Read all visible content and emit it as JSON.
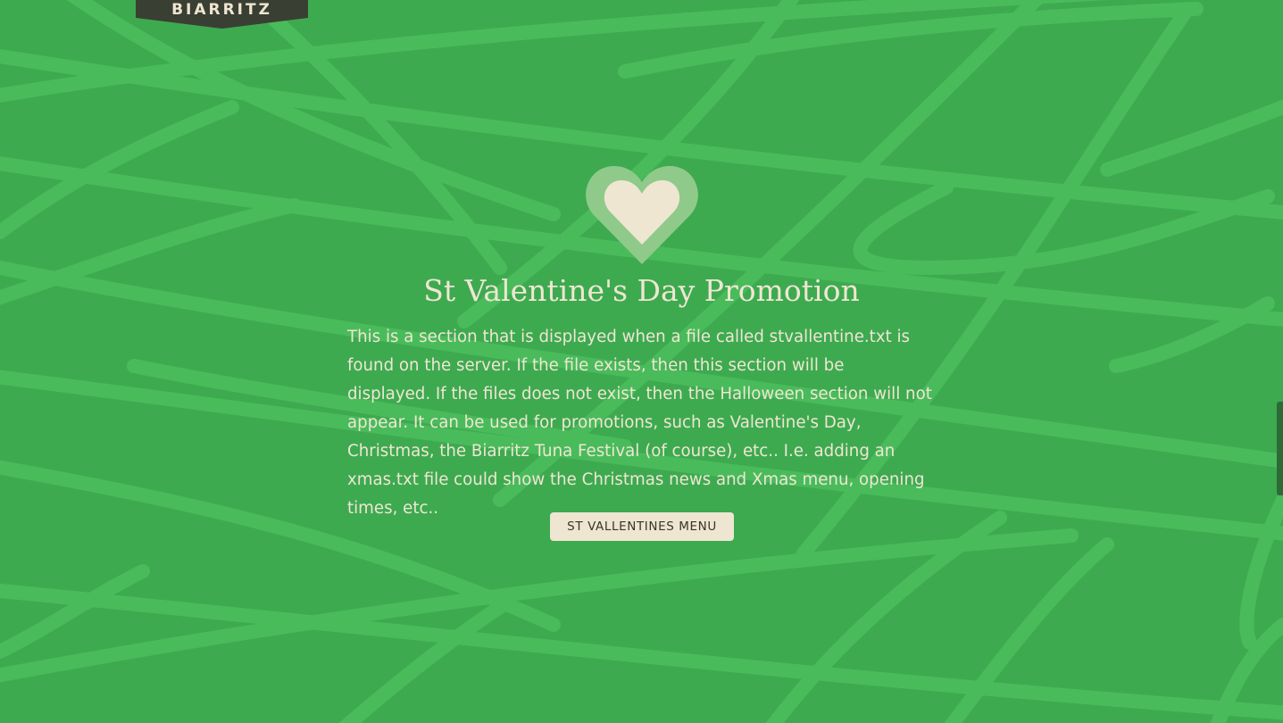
{
  "logo": {
    "text": "BIARRITZ"
  },
  "promo": {
    "icon": "heart-icon",
    "title": "St Valentine's Day Promotion",
    "body": "This is a section that is displayed when a file called stvallentine.txt is found on the server. If the file exists, then this section will be displayed. If the files does not exist, then the Halloween section will not appear. It can be used for promotions, such as Valentine's Day, Christmas, the Biarritz Tuna Festival (of course), etc.. I.e. adding an xmas.txt file could show the Christmas news and Xmas menu, opening times, etc..",
    "button_label": "ST VALLENTINES MENU"
  },
  "colors": {
    "background": "#3daa50",
    "scribble": "#4fc160",
    "cream": "#efe6d2",
    "badge": "#3a3f33"
  }
}
